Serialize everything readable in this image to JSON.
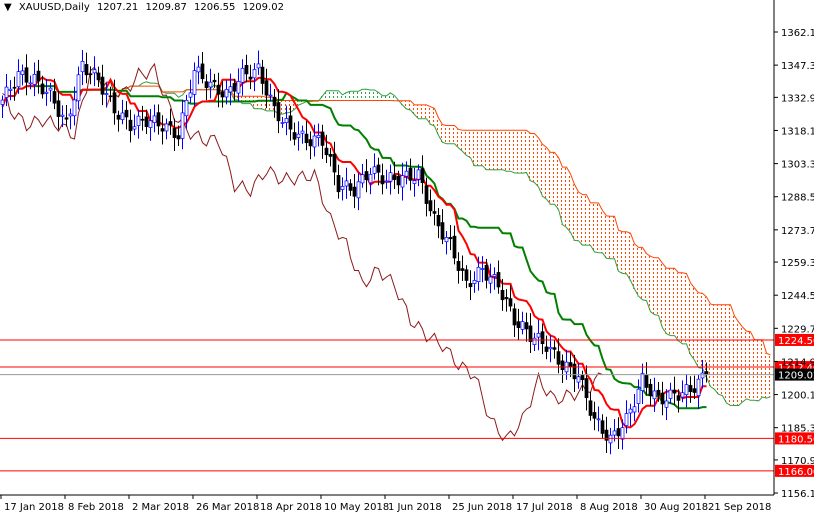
{
  "header": {
    "symbol": "XAUUSD,Daily",
    "open": "1207.21",
    "high": "1209.87",
    "low": "1206.55",
    "close": "1209.02"
  },
  "chart_data": {
    "type": "candlestick",
    "title": "XAUUSD,Daily",
    "ylim": [
      1152,
      1370
    ],
    "bars_per_point": 4,
    "closes": [
      1331.7,
      1342.9,
      1340.6,
      1334,
      1320.5,
      1347.4,
      1340.6,
      1327.3,
      1320.5,
      1322.8,
      1320.5,
      1316,
      1345.1,
      1338.4,
      1334,
      1342.9,
      1345.1,
      1327.3,
      1318.3,
      1313.8,
      1313.8,
      1293.7,
      1291.5,
      1300.4,
      1296,
      1296.9,
      1298.2,
      1278.1,
      1266.9,
      1249.1,
      1255.8,
      1249.1,
      1233.4,
      1226.7,
      1222.2,
      1213.3,
      1208.8,
      1188.7,
      1179.8,
      1188.7,
      1206.6,
      1197.7,
      1199.9,
      1202.1,
      1209
    ],
    "y_ticks": [
      "1362.10",
      "1347.30",
      "1332.90",
      "1318.10",
      "1303.30",
      "1288.50",
      "1273.70",
      "1259.30",
      "1244.50",
      "1229.70",
      "1214.90",
      "1200.10",
      "1185.30",
      "1170.90",
      "1156.10"
    ],
    "x_ticks": [
      "17 Jan 2018",
      "8 Feb 2018",
      "2 Mar 2018",
      "26 Mar 2018",
      "18 Apr 2018",
      "10 May 2018",
      "1 Jun 2018",
      "25 Jun 2018",
      "17 Jul 2018",
      "8 Aug 2018",
      "30 Aug 2018",
      "21 Sep 2018"
    ],
    "levels": [
      {
        "label": "1224.50",
        "value": 1224.5
      },
      {
        "label": "1212.40",
        "value": 1212.4
      },
      {
        "label": "1180.50",
        "value": 1180.5
      },
      {
        "label": "1166.00",
        "value": 1166.0
      }
    ],
    "current_price": {
      "label": "1209.02",
      "value": 1209.02
    },
    "colors": {
      "up": "#0000ff",
      "down": "#000000",
      "tenkan": "#ff0000",
      "kijun": "#008000",
      "chikou": "#8b1a1a",
      "cloud_bull": "#2ea043",
      "cloud_bear": "#ff4500",
      "level": "#ff0000"
    }
  }
}
